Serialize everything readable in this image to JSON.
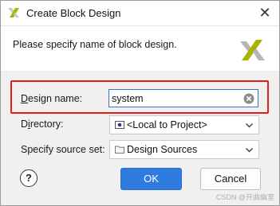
{
  "window": {
    "title": "Create Block Design"
  },
  "header": {
    "instruction": "Please specify name of block design."
  },
  "form": {
    "design_name": {
      "label_mnemonic": "D",
      "label_rest": "esign name:",
      "value": "system"
    },
    "directory": {
      "label_start": "D",
      "label_mnemonic": "i",
      "label_rest": "rectory:",
      "value": "<Local to Project>"
    },
    "source_set": {
      "label": "Specify source set:",
      "value": "Design Sources"
    }
  },
  "buttons": {
    "help": "?",
    "ok": "OK",
    "cancel": "Cancel"
  },
  "watermark": "CSDN @开曲幽室",
  "colors": {
    "accent": "#2f7be0",
    "highlight": "#e41b1b",
    "logo": "#a8b400"
  }
}
